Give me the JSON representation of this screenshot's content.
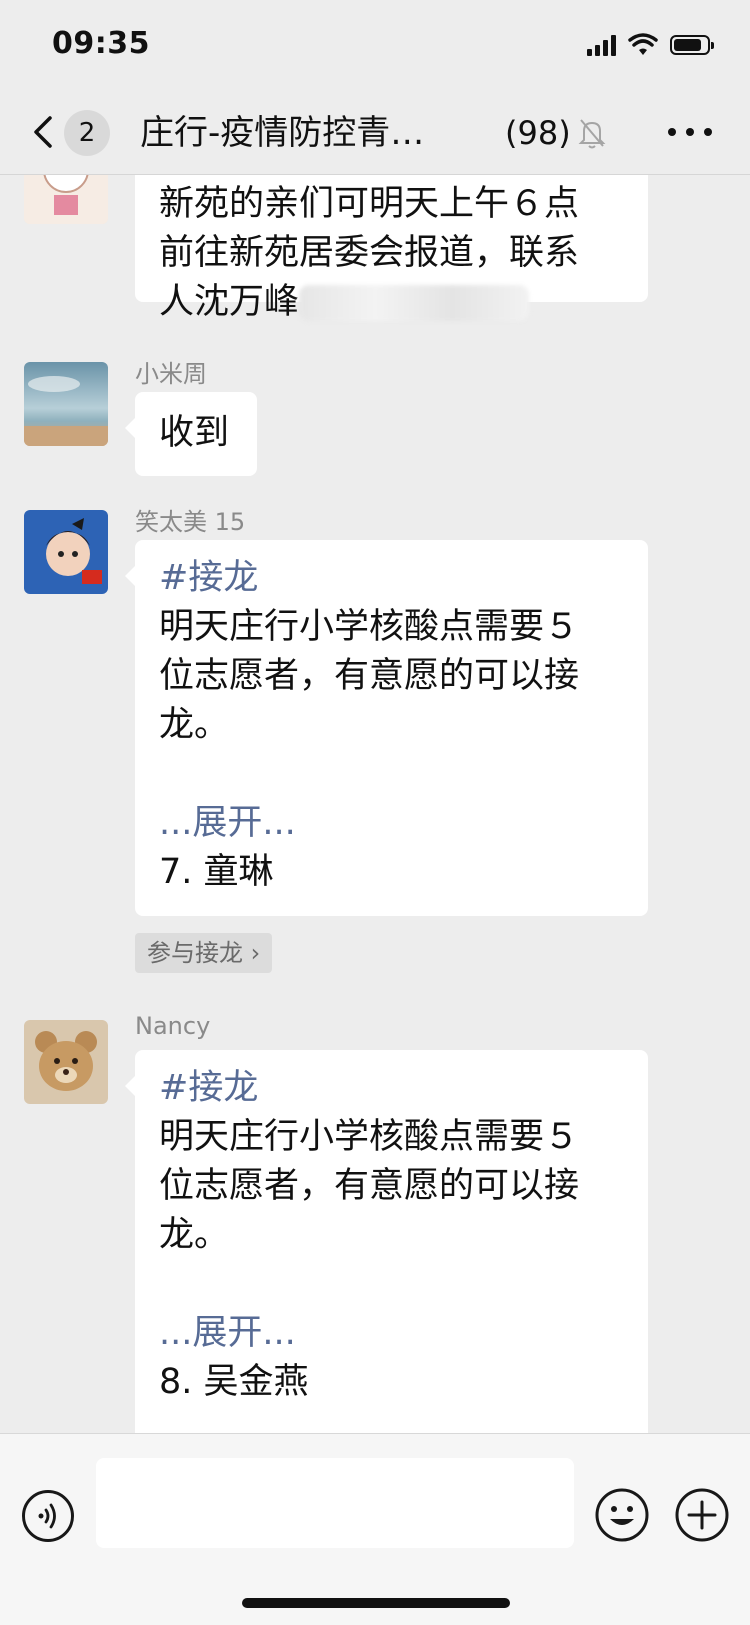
{
  "status_bar": {
    "time": "09:35",
    "battery_level": 0.85
  },
  "nav": {
    "back_badge": "2",
    "title": "庄行-疫情防控青…",
    "member_count": "(98)",
    "icons": [
      "back-icon",
      "mute-bell-icon",
      "more-icon"
    ]
  },
  "messages": [
    {
      "sender": "",
      "lines": [
        "新苑的亲们可明天上午６点",
        "前往新苑居委会报道，联系",
        "人沈万峰"
      ]
    },
    {
      "sender": "小米周",
      "text": "收到"
    },
    {
      "sender": "笑太美 15",
      "tag": "#接龙",
      "lines": [
        "明天庄行小学核酸点需要５",
        "位志愿者，有意愿的可以接",
        "龙。"
      ],
      "expand": "...展开...",
      "entry": "7. 童琳",
      "join_label": "参与接龙 ›"
    },
    {
      "sender": "Nancy",
      "tag": "#接龙",
      "lines": [
        "明天庄行小学核酸点需要５",
        "位志愿者，有意愿的可以接",
        "龙。"
      ],
      "expand": "...展开...",
      "entry": "8. 吴金燕"
    }
  ],
  "input_bar": {
    "placeholder": "",
    "icons": [
      "voice-icon",
      "emoji-icon",
      "plus-icon"
    ]
  },
  "colors": {
    "background": "#ededed",
    "link": "#576b95",
    "bubble": "#ffffff"
  }
}
